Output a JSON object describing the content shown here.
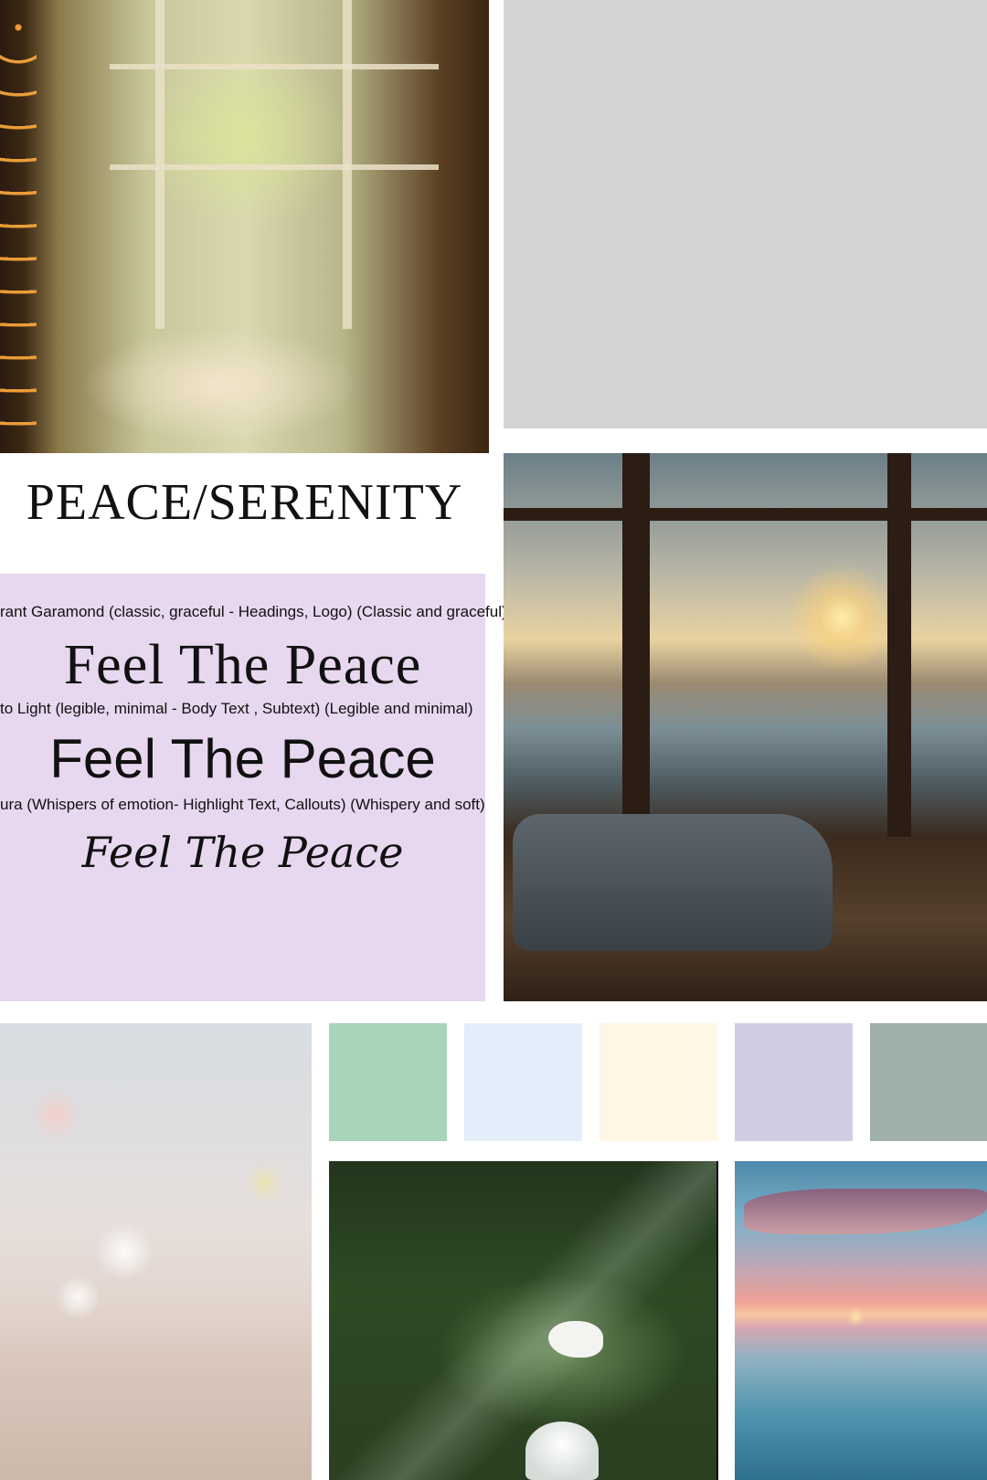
{
  "title": "PEACE/SERENITY",
  "typography": {
    "notes": [
      "rant Garamond (classic, graceful - Headings, Logo) (Classic and graceful)",
      "to Light (legible, minimal - Body Text , Subtext) (Legible and minimal)",
      "ura (Whispers of emotion- Highlight Text, Callouts) (Whispery and soft)"
    ],
    "samples": [
      "Feel The Peace",
      "Feel The Peace",
      "Feel The Peace"
    ]
  },
  "palette": [
    "#a8d4b8",
    "#e2eef9",
    "#fff6e6",
    "#d0cde2",
    "#9fb0ab"
  ],
  "colors": {
    "panel": "#e7d7ef",
    "placeholder": "#d4d4d4"
  }
}
